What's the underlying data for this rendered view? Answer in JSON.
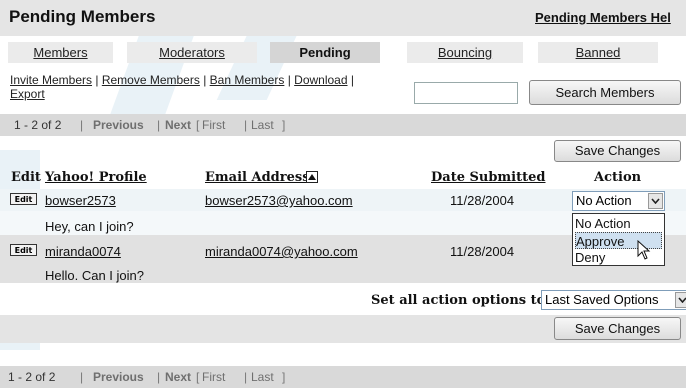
{
  "header": {
    "title": "Pending Members",
    "help_link": "Pending Members Hel"
  },
  "tabs": [
    {
      "label": "Members",
      "active": false
    },
    {
      "label": "Moderators",
      "active": false
    },
    {
      "label": "Pending",
      "active": true
    },
    {
      "label": "Bouncing",
      "active": false
    },
    {
      "label": "Banned",
      "active": false
    }
  ],
  "actions": {
    "invite": "Invite Members",
    "remove": "Remove Members",
    "ban": "Ban Members",
    "download": "Download",
    "export": "Export",
    "separator": " | ",
    "trailing_separator": " |"
  },
  "search": {
    "value": "",
    "button_label": "Search Members"
  },
  "pager": {
    "count": "1 - 2 of 2",
    "previous": "Previous",
    "next": "Next",
    "first": "First",
    "last": "Last",
    "sep": "|",
    "open_bracket": "[",
    "close_bracket": "]"
  },
  "save_button": "Save Changes",
  "table": {
    "headers": {
      "edit": "Edit",
      "profile": "Yahoo! Profile",
      "email": "Email Address",
      "date": "Date Submitted",
      "action": "Action"
    },
    "edit_label": "Edit",
    "rows": [
      {
        "profile": "bowser2573",
        "email": "bowser2573@yahoo.com",
        "date": "11/28/2004",
        "message": "Hey, can I join?",
        "action": "No Action"
      },
      {
        "profile": "miranda0074",
        "email": "miranda0074@yahoo.com",
        "date": "11/28/2004",
        "message": "Hello. Can I join?",
        "action": ""
      }
    ]
  },
  "dropdown": {
    "open": true,
    "options": [
      "No Action",
      "Approve",
      "Deny"
    ],
    "highlighted": "Approve"
  },
  "bulk": {
    "label": "Set all action options to:",
    "value": "Last Saved Options"
  },
  "colors": {
    "header_bg": "#e5e5e5",
    "pager_bg": "#d9d9d9",
    "tab_active_bg": "#d5d5d5",
    "link": "#222222",
    "watermark": "#d7e8f1"
  },
  "icons": {
    "sort": "sort-up-icon",
    "dropdown": "chevron-down-icon",
    "cursor": "mouse-pointer-icon"
  }
}
